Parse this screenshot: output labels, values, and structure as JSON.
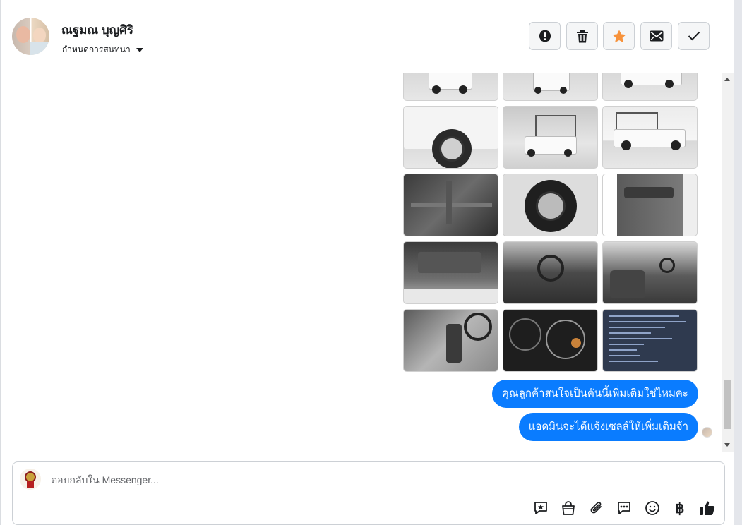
{
  "header": {
    "contact_name": "ณฐมณ บุญศิริ",
    "set_conversation_label": "กำหนดการสนทนา",
    "actions": [
      {
        "name": "mark-spam-button",
        "icon": "exclamation-circle-icon"
      },
      {
        "name": "delete-button",
        "icon": "trash-icon"
      },
      {
        "name": "star-button",
        "icon": "star-icon",
        "color": "#f7923b"
      },
      {
        "name": "mark-unread-button",
        "icon": "envelope-icon"
      },
      {
        "name": "mark-done-button",
        "icon": "check-icon"
      }
    ]
  },
  "thread": {
    "photos": [
      {
        "kind": "truck-rear-low"
      },
      {
        "kind": "truck-rear-low"
      },
      {
        "kind": "truck-side-low"
      },
      {
        "kind": "wheel-arch"
      },
      {
        "kind": "truck-cage-rear"
      },
      {
        "kind": "truck-cage-side"
      },
      {
        "kind": "undercarriage"
      },
      {
        "kind": "spare-wheel"
      },
      {
        "kind": "door-panel"
      },
      {
        "kind": "engine-bay"
      },
      {
        "kind": "dashboard"
      },
      {
        "kind": "interior-seats"
      },
      {
        "kind": "gear-console"
      },
      {
        "kind": "gauge-cluster"
      },
      {
        "kind": "spec-sheet"
      }
    ],
    "messages": [
      {
        "text": "คุณลูกค้าสนใจเป็นคันนี้เพิ่มเติมใช่ไหมคะ"
      },
      {
        "text": "แอดมินจะได้แจ้งเซลล์ให้เพิ่มเติมจ้า"
      }
    ],
    "bubble_color": "#0a7cff"
  },
  "composer": {
    "placeholder": "ตอบกลับใน Messenger...",
    "tools": [
      {
        "name": "saved-reply-button",
        "icon": "star-bubble-icon"
      },
      {
        "name": "product-button",
        "icon": "shopping-bag-icon"
      },
      {
        "name": "attach-button",
        "icon": "paperclip-icon"
      },
      {
        "name": "quick-reply-button",
        "icon": "chat-dots-icon"
      },
      {
        "name": "emoji-button",
        "icon": "smile-icon"
      },
      {
        "name": "payment-button",
        "icon": "baht-icon"
      },
      {
        "name": "like-button",
        "icon": "thumbs-up-icon"
      }
    ],
    "baht_glyph": "฿"
  }
}
